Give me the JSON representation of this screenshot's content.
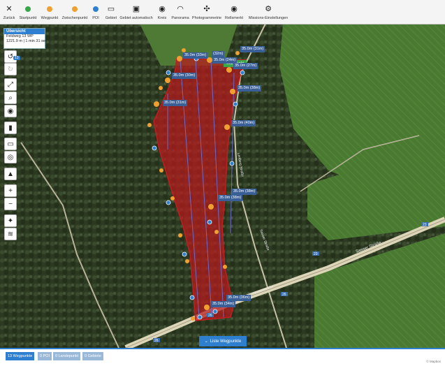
{
  "toolbar": {
    "items": [
      {
        "label": "Zurück",
        "icon": "close-icon",
        "glyph": "✕",
        "color": "#222222"
      },
      {
        "label": "Startpunkt",
        "icon": "start-point-icon",
        "glyph": "dot",
        "color": "#3aa64a"
      },
      {
        "label": "Wegpunkt",
        "icon": "waypoint-icon",
        "glyph": "dot",
        "color": "#f0a030"
      },
      {
        "label": "Zwischenpunkt",
        "icon": "intermediate-point-icon",
        "glyph": "dot",
        "color": "#f0a030"
      },
      {
        "label": "POI",
        "icon": "poi-icon",
        "glyph": "dot",
        "color": "#2f7fd0"
      },
      {
        "label": "Gebiet",
        "icon": "area-icon",
        "glyph": "▭",
        "color": "#222222"
      },
      {
        "label": "Gebiet automatisch",
        "icon": "auto-area-icon",
        "glyph": "▣",
        "color": "#222222"
      },
      {
        "label": "Kreis",
        "icon": "circle-icon",
        "glyph": "◉",
        "color": "#222222"
      },
      {
        "label": "Panorama",
        "icon": "panorama-icon",
        "glyph": "◠",
        "color": "#222222"
      },
      {
        "label": "Photogrammetrie",
        "icon": "photogrammetry-icon",
        "glyph": "✣",
        "color": "#222222"
      },
      {
        "label": "Rellsmerkt",
        "icon": "eye-icon",
        "glyph": "◉",
        "color": "#222222"
      },
      {
        "label": "Missions-Einstellungen",
        "icon": "gear-icon",
        "glyph": "⚙",
        "color": "#222222"
      }
    ]
  },
  "info": {
    "title": "Übersicht",
    "line1": "Feldweg 13 WP",
    "line2": "1221.9 m | 1 min 31 sec"
  },
  "sidebar": {
    "badge": "13",
    "buttons": [
      {
        "name": "undo-icon",
        "glyph": "↺"
      },
      {
        "name": "redo-icon",
        "glyph": "↻"
      },
      {
        "name": "fit-bounds-icon",
        "glyph": "⤢"
      },
      {
        "name": "search-icon",
        "glyph": "⌕"
      },
      {
        "name": "eye-icon",
        "glyph": "◉"
      },
      {
        "name": "trash-icon",
        "glyph": "🗑"
      },
      {
        "name": "ruler-icon",
        "glyph": "▭"
      },
      {
        "name": "locate-icon",
        "glyph": "◎"
      },
      {
        "name": "north-arrow-icon",
        "glyph": "▲"
      },
      {
        "name": "zoom-in-icon",
        "glyph": "+"
      },
      {
        "name": "zoom-out-icon",
        "glyph": "−"
      },
      {
        "name": "satellite-icon",
        "glyph": "✦"
      },
      {
        "name": "layers-icon",
        "glyph": "≋"
      }
    ]
  },
  "map": {
    "start_label": "Startpunkt",
    "waypoint_labels": [
      "35.0m (33m)",
      "(32m)",
      "35.0m (31m)",
      "35.0m (24m)",
      "35.0m (27m)",
      "35.0m (30m)",
      "35.0m (38m)",
      "35.0m (31m)",
      "35.0m (40m)",
      "35.0m (38m)",
      "35.0m (38m)",
      "35.0m (36m)",
      "35.0m (34m)"
    ],
    "road_labels": [
      "Sasser Straße",
      "Lenberg Straße",
      "Hessenstraße",
      "Sasser Straße"
    ],
    "road_numbers": [
      "23",
      "23",
      "26",
      "26",
      "26"
    ]
  },
  "list_button": "Liste Wegpunkte",
  "bottom_tabs": [
    "13 Wegpunkte",
    "0 POI",
    "0 Landepunkt",
    "0 Gebiete"
  ],
  "credit": "© Mapbox"
}
